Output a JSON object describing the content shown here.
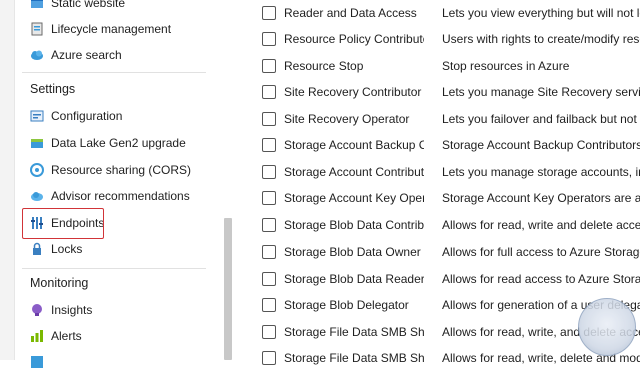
{
  "sidebar": {
    "top_items": [
      {
        "label": "Static website",
        "icon": "static-website-icon"
      },
      {
        "label": "Lifecycle management",
        "icon": "lifecycle-icon"
      },
      {
        "label": "Azure search",
        "icon": "cloud-search-icon"
      }
    ],
    "settings_header": "Settings",
    "settings_items": [
      {
        "label": "Configuration",
        "icon": "configuration-icon"
      },
      {
        "label": "Data Lake Gen2 upgrade",
        "icon": "data-lake-icon"
      },
      {
        "label": "Resource sharing (CORS)",
        "icon": "cors-icon"
      },
      {
        "label": "Advisor recommendations",
        "icon": "advisor-icon"
      },
      {
        "label": "Endpoints",
        "icon": "endpoints-icon"
      },
      {
        "label": "Locks",
        "icon": "lock-icon"
      }
    ],
    "monitoring_header": "Monitoring",
    "monitoring_items": [
      {
        "label": "Insights",
        "icon": "insights-icon"
      },
      {
        "label": "Alerts",
        "icon": "alerts-icon"
      }
    ],
    "highlight_color": "#d13438"
  },
  "roles": [
    {
      "name": "Reader and Data Access",
      "desc": "Lets you view everything but will not let y"
    },
    {
      "name": "Resource Policy Contributor",
      "desc": "Users with rights to create/modify resourc"
    },
    {
      "name": "Resource Stop",
      "desc": "Stop resources in Azure"
    },
    {
      "name": "Site Recovery Contributor",
      "desc": "Lets you manage Site Recovery service exc"
    },
    {
      "name": "Site Recovery Operator",
      "desc": "Lets you failover and failback but not perf"
    },
    {
      "name": "Storage Account Backup Contr...",
      "desc": "Storage Account Backup Contributors are"
    },
    {
      "name": "Storage Account Contributor",
      "desc": "Lets you manage storage accounts, includ"
    },
    {
      "name": "Storage Account Key Operato...",
      "desc": "Storage Account Key Operators are allow"
    },
    {
      "name": "Storage Blob Data Contributor",
      "desc": "Allows for read, write and delete access to"
    },
    {
      "name": "Storage Blob Data Owner",
      "desc": "Allows for full access to Azure Storage blo"
    },
    {
      "name": "Storage Blob Data Reader",
      "desc": "Allows for read access to Azure Storage bl"
    },
    {
      "name": "Storage Blob Delegator",
      "desc": "Allows for generation of a user delegation"
    },
    {
      "name": "Storage File Data SMB Share ...",
      "desc": "Allows for read, write, and delete access o"
    },
    {
      "name": "Storage File Data SMB Share ...",
      "desc": "Allows for read, write, delete and modify"
    }
  ]
}
